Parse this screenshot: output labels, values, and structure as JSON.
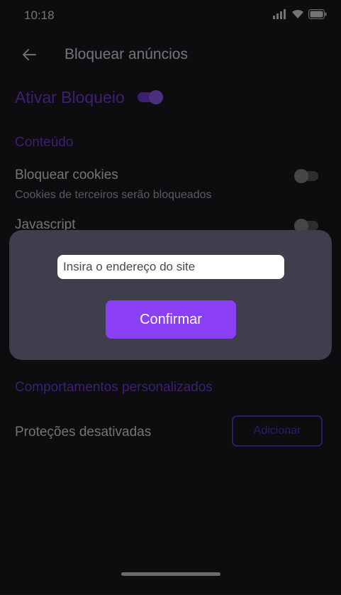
{
  "status_bar": {
    "time": "10:18",
    "icons": [
      "signal-icon",
      "wifi-icon",
      "battery-icon"
    ]
  },
  "app_bar": {
    "back_icon": "arrow-left-icon",
    "title": "Bloquear anúncios"
  },
  "enable": {
    "label": "Ativar Bloqueio",
    "enabled": true
  },
  "content_section": {
    "title": "Conteúdo",
    "items": [
      {
        "title": "Bloquear cookies",
        "subtitle": "Cookies de terceiros serão bloqueados",
        "enabled": false
      },
      {
        "title": "Javascript",
        "enabled": false
      }
    ]
  },
  "custom_section": {
    "title": "Comportamentos personalizados",
    "protections_label": "Proteções desativadas",
    "add_button": "Adicionar"
  },
  "dialog": {
    "input_placeholder": "Insira o endereço do site",
    "input_value": "",
    "confirm_button": "Confirmar"
  },
  "colors": {
    "accent": "#7b3fe4",
    "confirm_button": "#8b3ff5",
    "background": "#1a191c",
    "dialog_background": "#403d4d"
  }
}
